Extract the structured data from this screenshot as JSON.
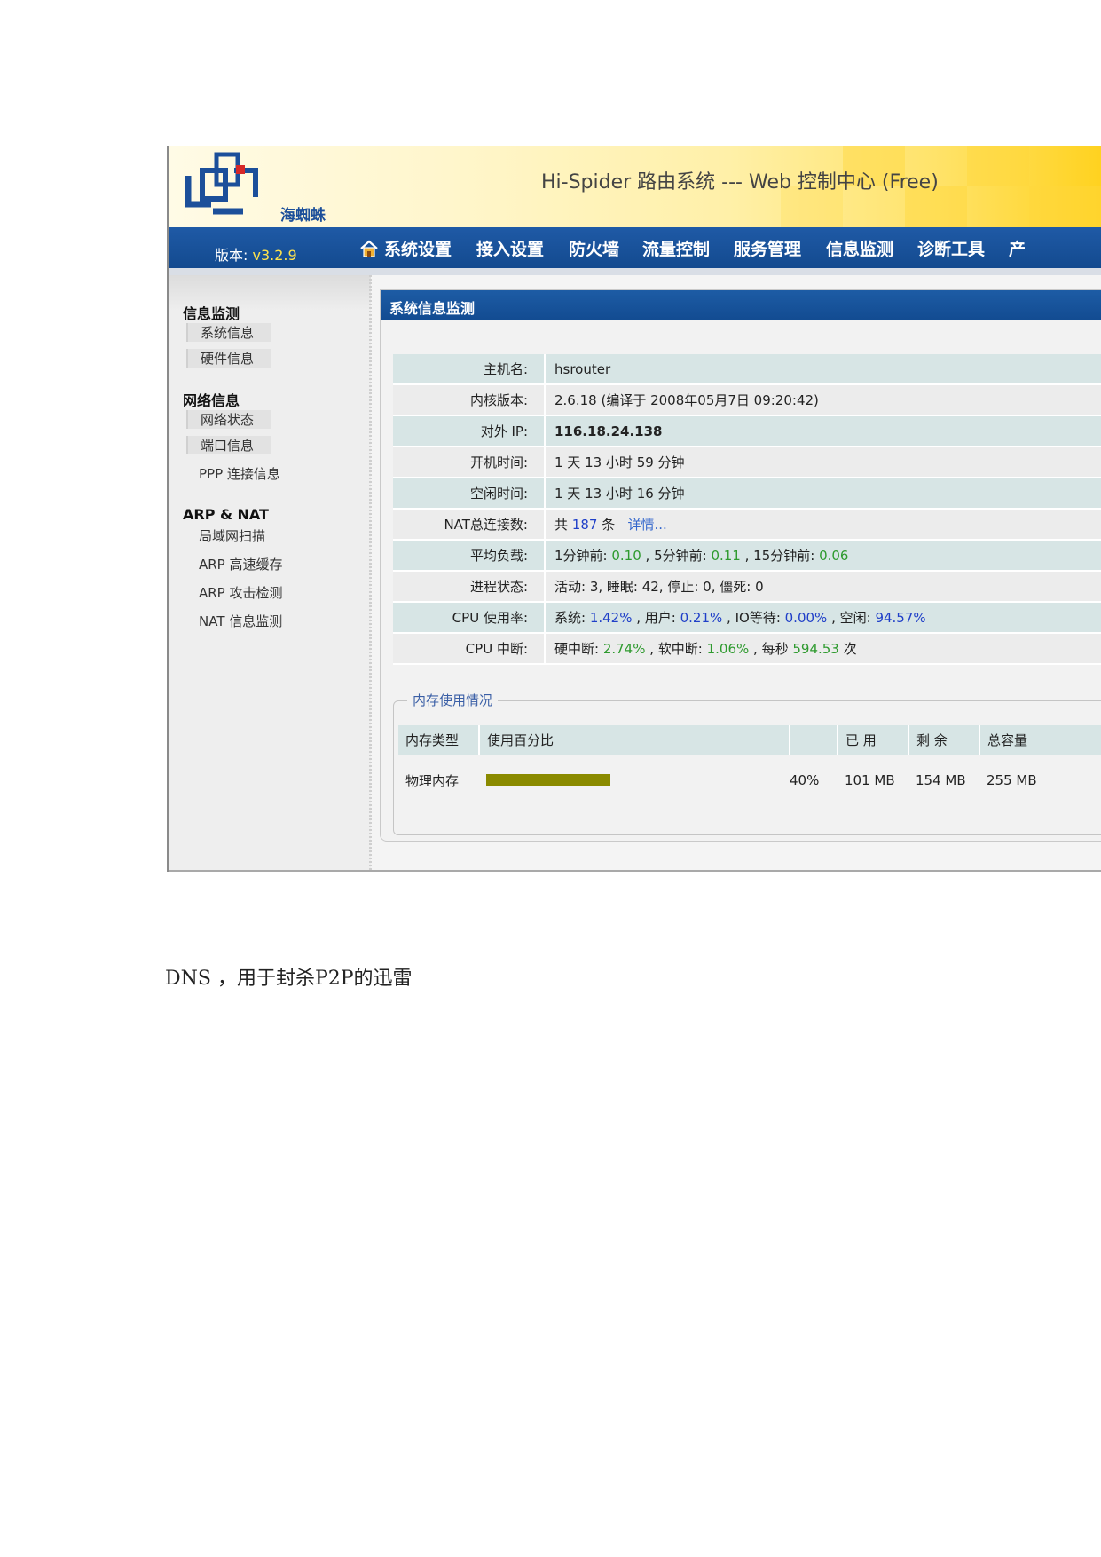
{
  "header": {
    "logo_text": "海蜘蛛",
    "title": "Hi-Spider 路由系统 --- Web 控制中心 (Free)"
  },
  "nav": {
    "version_label": "版本: ",
    "version_value": "v3.2.9",
    "items": [
      "系统设置",
      "接入设置",
      "防火墙",
      "流量控制",
      "服务管理",
      "信息监测",
      "诊断工具",
      "产"
    ]
  },
  "sidebar": {
    "groups": [
      {
        "title": "信息监测",
        "items": [
          "系统信息",
          "硬件信息"
        ]
      },
      {
        "title": "网络信息",
        "items": [
          "网络状态",
          "端口信息",
          "PPP 连接信息"
        ]
      },
      {
        "title": "ARP & NAT",
        "items": [
          "局域网扫描",
          "ARP 高速缓存",
          "ARP 攻击检测",
          "NAT 信息监测"
        ]
      }
    ]
  },
  "panel": {
    "title": "系统信息监测",
    "rows": {
      "hostname": {
        "label": "主机名:",
        "value": "hsrouter"
      },
      "kernel": {
        "label": "内核版本:",
        "value": "2.6.18 (编译于 2008年05月7日 09:20:42)"
      },
      "ip": {
        "label": "对外 IP:",
        "value": "116.18.24.138"
      },
      "uptime": {
        "label": "开机时间:",
        "value": "1 天 13 小时 59 分钟"
      },
      "idle": {
        "label": "空闲时间:",
        "value": "1 天 13 小时 16 分钟"
      },
      "nat": {
        "label": "NAT总连接数:",
        "prefix": "共 ",
        "count": "187",
        "suffix": " 条",
        "link": "详情..."
      },
      "load": {
        "label": "平均负载:",
        "l1_label": "1分钟前: ",
        "l1": "0.10",
        "l5_label": " , 5分钟前: ",
        "l5": "0.11",
        "l15_label": " , 15分钟前: ",
        "l15": "0.06"
      },
      "proc": {
        "label": "进程状态:",
        "value": "活动: 3, 睡眠: 42, 停止: 0, 僵死: 0"
      },
      "cpu": {
        "label": "CPU 使用率:",
        "sys_label": "系统: ",
        "sys": "1.42%",
        "user_label": " , 用户: ",
        "user": "0.21%",
        "io_label": " , IO等待: ",
        "io": "0.00%",
        "idle_label": " , 空闲: ",
        "idle": "94.57%"
      },
      "irq": {
        "label": "CPU 中断:",
        "hard_label": "硬中断: ",
        "hard": "2.74%",
        "soft_label": " , 软中断: ",
        "soft": "1.06%",
        "rate_label": " , 每秒 ",
        "rate": "594.53",
        "rate_unit": " 次"
      }
    },
    "memory": {
      "legend": "内存使用情况",
      "headers": {
        "type": "内存类型",
        "percent": "使用百分比",
        "used": "已 用",
        "free": "剩 余",
        "total": "总容量"
      },
      "row": {
        "type": "物理内存",
        "usage_fraction": 0.4,
        "percent": "40%",
        "used": "101 MB",
        "free": "154 MB",
        "total": "255 MB"
      }
    }
  },
  "doc": {
    "line": "DNS ，用于封杀P2P的迅雷"
  },
  "colors": {
    "nav_blue": "#1a539c",
    "memory_bar": "#8a8a00",
    "value_green": "#2e9a2e",
    "value_blue": "#1f3fc8"
  }
}
